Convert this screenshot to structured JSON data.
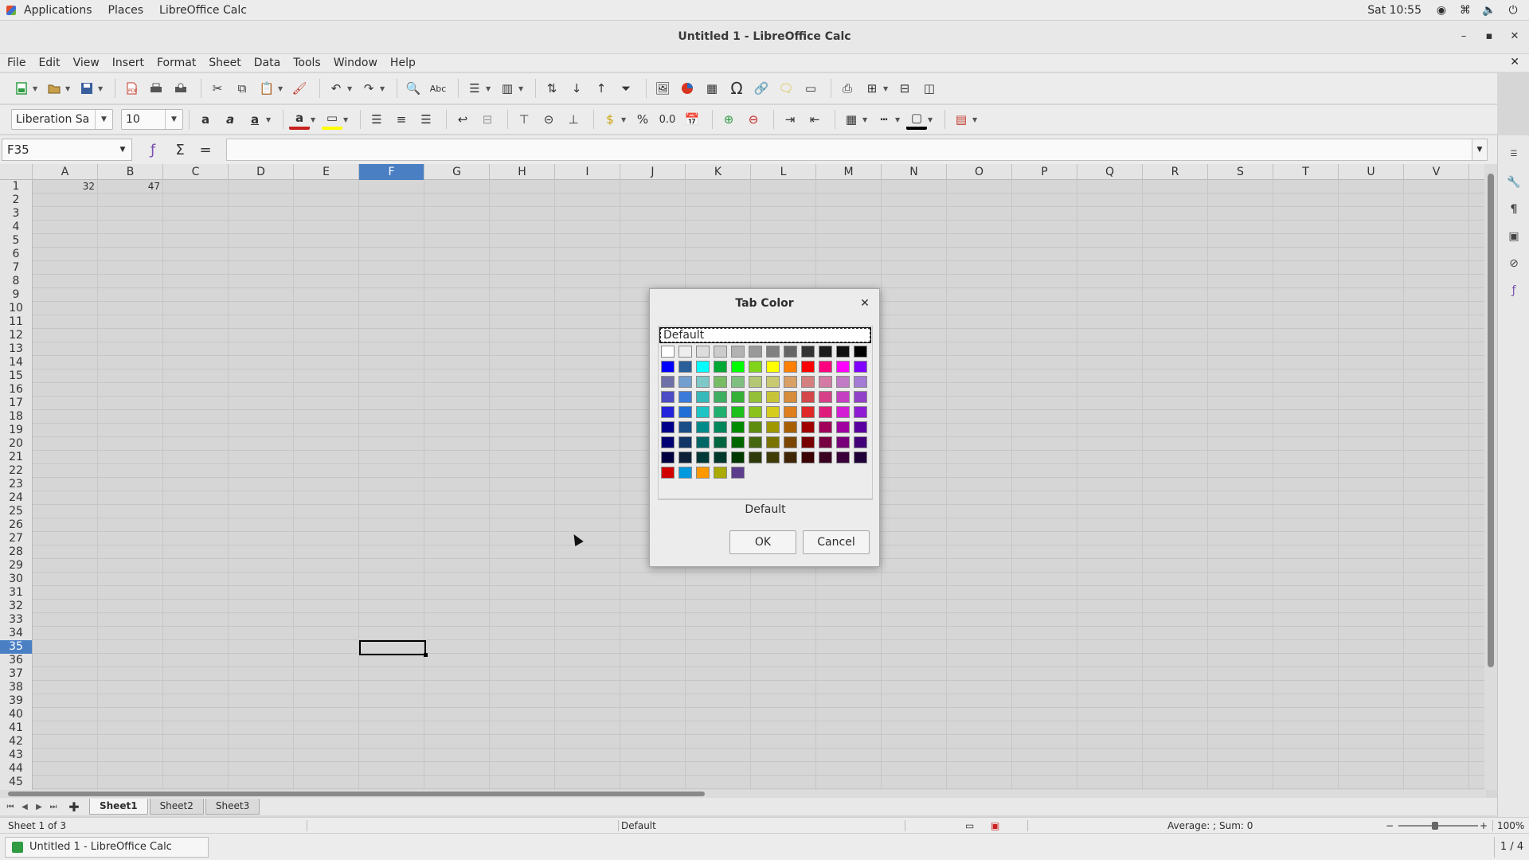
{
  "top_panel": {
    "applications": "Applications",
    "places": "Places",
    "app_name": "LibreOffice Calc",
    "clock": "Sat 10:55"
  },
  "window": {
    "title": "Untitled 1 - LibreOffice Calc",
    "minimize": "–",
    "maximize": "▪",
    "close": "✕"
  },
  "menu": [
    "File",
    "Edit",
    "View",
    "Insert",
    "Format",
    "Sheet",
    "Data",
    "Tools",
    "Window",
    "Help"
  ],
  "toolbar2": {
    "font_name": "Liberation Sa",
    "font_size": "10",
    "percent": "%",
    "decimal": "0.0"
  },
  "formula_bar": {
    "name_box": "F35",
    "sigma": "Σ",
    "equals": "="
  },
  "columns": [
    "A",
    "B",
    "C",
    "D",
    "E",
    "F",
    "G",
    "H",
    "I",
    "J",
    "K",
    "L",
    "M",
    "N",
    "O",
    "P",
    "Q",
    "R",
    "S",
    "T",
    "U",
    "V"
  ],
  "selected_column": "F",
  "rows": [
    "1",
    "2",
    "3",
    "4",
    "5",
    "6",
    "7",
    "8",
    "9",
    "10",
    "11",
    "12",
    "13",
    "14",
    "15",
    "16",
    "17",
    "18",
    "19",
    "20",
    "21",
    "22",
    "23",
    "24",
    "25",
    "26",
    "27",
    "28",
    "29",
    "30",
    "31",
    "32",
    "33",
    "34",
    "35",
    "36",
    "37",
    "38",
    "39",
    "40",
    "41",
    "42",
    "43",
    "44",
    "45"
  ],
  "selected_row": "35",
  "cells": {
    "A1": "32",
    "B1": "47"
  },
  "sheet_tabs": [
    "Sheet1",
    "Sheet2",
    "Sheet3"
  ],
  "active_sheet": "Sheet1",
  "status_bar": {
    "sheet_info": "Sheet 1 of 3",
    "page_style": "Default",
    "summary": "Average: ; Sum: 0",
    "zoom": "100%"
  },
  "taskbar": {
    "item": "Untitled 1 - LibreOffice Calc",
    "workspace": "1 / 4"
  },
  "dialog": {
    "title": "Tab Color",
    "palette_name": "Default",
    "selected_color_name": "Default",
    "ok": "OK",
    "cancel": "Cancel",
    "swatch_rows": [
      [
        "#ffffff",
        "#eeeeee",
        "#dddddd",
        "#cccccc",
        "#b2b2b2",
        "#999999",
        "#808080",
        "#666666",
        "#333333",
        "#1c1c1c",
        "#111111",
        "#000000"
      ],
      [
        "#0000ff",
        "#2a6099",
        "#00ffff",
        "#00a933",
        "#00ff00",
        "#81d41a",
        "#ffff00",
        "#ff8000",
        "#ff0000",
        "#ff007f",
        "#ff00ff",
        "#8000ff"
      ],
      [
        "#7070a8",
        "#729fcf",
        "#7fc8c8",
        "#77bc65",
        "#7fbf7f",
        "#b4c774",
        "#c9c972",
        "#d9a066",
        "#d48080",
        "#d47ba5",
        "#c07bc4",
        "#a37bd4"
      ],
      [
        "#4c4cc4",
        "#3b7ad8",
        "#38b8b8",
        "#3fae60",
        "#36b036",
        "#94bf38",
        "#c8c438",
        "#d68c3a",
        "#d4474a",
        "#d64088",
        "#c340c3",
        "#9140c8"
      ],
      [
        "#2323dc",
        "#1f6fd6",
        "#1cc4c4",
        "#20b06e",
        "#1cc01c",
        "#8cc21c",
        "#d6cc1c",
        "#df7e1c",
        "#df2828",
        "#df1c7c",
        "#d41cd4",
        "#8f1cd4"
      ],
      [
        "#00008b",
        "#184d87",
        "#008b8b",
        "#00875a",
        "#008b00",
        "#5e8c0e",
        "#a09800",
        "#a85f00",
        "#a00000",
        "#a0005a",
        "#a000a0",
        "#5b00a0"
      ],
      [
        "#000073",
        "#103566",
        "#006666",
        "#006640",
        "#006600",
        "#466610",
        "#7a7300",
        "#7a4600",
        "#780000",
        "#780042",
        "#780078",
        "#420078"
      ],
      [
        "#000040",
        "#0d2038",
        "#003838",
        "#00382b",
        "#003800",
        "#2e3a0c",
        "#3f3c06",
        "#3f2506",
        "#3a0000",
        "#3a0020",
        "#3a003a",
        "#1f0038"
      ],
      [
        "#d00000",
        "#0099dd",
        "#ff9900",
        "#aaaa00",
        "#5c3c8c"
      ]
    ]
  }
}
